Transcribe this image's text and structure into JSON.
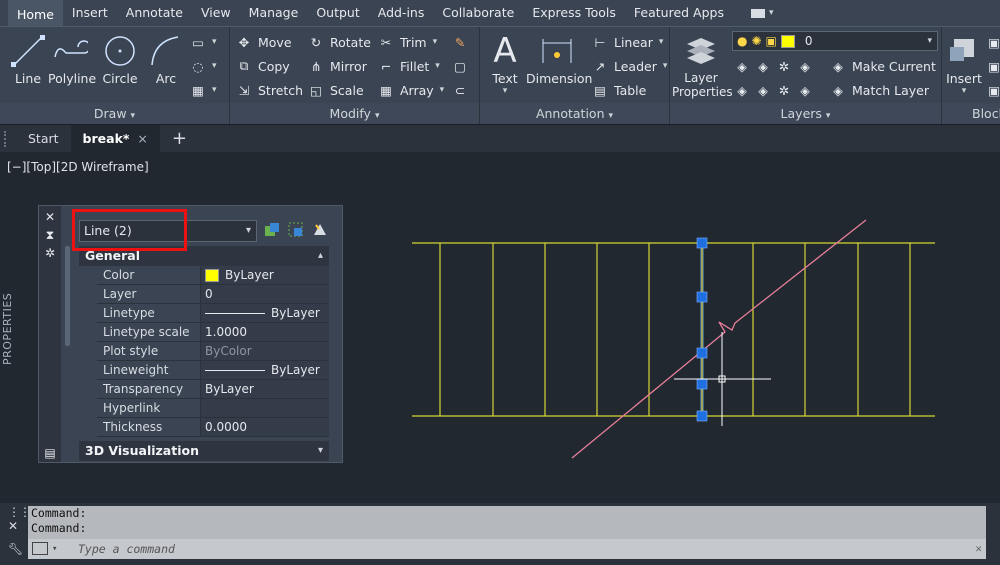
{
  "ribbon_tabs": [
    "Home",
    "Insert",
    "Annotate",
    "View",
    "Manage",
    "Output",
    "Add-ins",
    "Collaborate",
    "Express Tools",
    "Featured Apps"
  ],
  "active_tab": "Home",
  "draw": {
    "title": "Draw",
    "line": "Line",
    "polyline": "Polyline",
    "circle": "Circle",
    "arc": "Arc"
  },
  "modify": {
    "title": "Modify",
    "move": "Move",
    "rotate": "Rotate",
    "trim": "Trim",
    "copy": "Copy",
    "mirror": "Mirror",
    "fillet": "Fillet",
    "stretch": "Stretch",
    "scale": "Scale",
    "array": "Array"
  },
  "annotation": {
    "title": "Annotation",
    "text": "Text",
    "dimension": "Dimension",
    "linear": "Linear",
    "leader": "Leader",
    "table": "Table"
  },
  "layers": {
    "title": "Layers",
    "layer_properties_l1": "Layer",
    "layer_properties_l2": "Properties",
    "current_layer": "0",
    "make_current": "Make Current",
    "match_layer": "Match Layer"
  },
  "block": {
    "insert": "Insert",
    "title_partial": "Block"
  },
  "file_tabs": {
    "start": "Start",
    "active": "break*",
    "close": "×",
    "add": "+"
  },
  "viewport_label": "[−][Top][2D Wireframe]",
  "properties": {
    "palette_title": "PROPERTIES",
    "selection": "Line (2)",
    "general_section": "General",
    "visualization_section": "3D Visualization",
    "rows": [
      {
        "key": "Color",
        "value": "ByLayer",
        "kind": "color"
      },
      {
        "key": "Layer",
        "value": "0",
        "kind": "text"
      },
      {
        "key": "Linetype",
        "value": "ByLayer",
        "kind": "line"
      },
      {
        "key": "Linetype scale",
        "value": "1.0000",
        "kind": "text"
      },
      {
        "key": "Plot style",
        "value": "ByColor",
        "kind": "dim"
      },
      {
        "key": "Lineweight",
        "value": "ByLayer",
        "kind": "line"
      },
      {
        "key": "Transparency",
        "value": "ByLayer",
        "kind": "text"
      },
      {
        "key": "Hyperlink",
        "value": "",
        "kind": "text"
      },
      {
        "key": "Thickness",
        "value": "0.0000",
        "kind": "text"
      }
    ]
  },
  "command": {
    "history": [
      "Command:",
      "Command:"
    ],
    "placeholder": "Type a command"
  },
  "colors": {
    "accent_yellow": "#ffff00",
    "grip_blue": "#1f6fe0",
    "break_line_pink": "#e87f9a",
    "highlight_red": "#ee1111"
  }
}
